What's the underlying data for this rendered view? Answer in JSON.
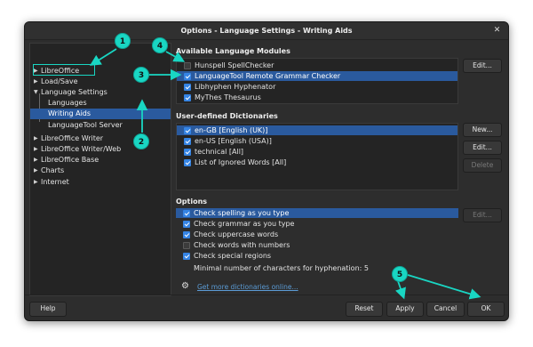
{
  "window": {
    "title": "Options - Language Settings - Writing Aids"
  },
  "tree": {
    "items": [
      {
        "label": "LibreOffice",
        "arrow": "▶"
      },
      {
        "label": "Load/Save",
        "arrow": "▶"
      },
      {
        "label": "Language Settings",
        "arrow": "▼"
      },
      {
        "label": "Languages",
        "arrow": ""
      },
      {
        "label": "Writing Aids",
        "arrow": ""
      },
      {
        "label": "LanguageTool Server",
        "arrow": ""
      },
      {
        "label": "LibreOffice Writer",
        "arrow": "▶"
      },
      {
        "label": "LibreOffice Writer/Web",
        "arrow": "▶"
      },
      {
        "label": "LibreOffice Base",
        "arrow": "▶"
      },
      {
        "label": "Charts",
        "arrow": "▶"
      },
      {
        "label": "Internet",
        "arrow": "▶"
      }
    ]
  },
  "modules": {
    "title": "Available Language Modules",
    "items": [
      {
        "label": "Hunspell SpellChecker",
        "checked": false
      },
      {
        "label": "LanguageTool Remote Grammar Checker",
        "checked": true
      },
      {
        "label": "Libhyphen Hyphenator",
        "checked": true
      },
      {
        "label": "MyThes Thesaurus",
        "checked": true
      }
    ],
    "edit_label": "Edit..."
  },
  "dictionaries": {
    "title": "User-defined Dictionaries",
    "items": [
      {
        "label": "en-GB [English (UK)]",
        "checked": true
      },
      {
        "label": "en-US [English (USA)]",
        "checked": true
      },
      {
        "label": "technical [All]",
        "checked": true
      },
      {
        "label": "List of Ignored Words [All]",
        "checked": true
      }
    ],
    "new_label": "New...",
    "edit_label": "Edit...",
    "delete_label": "Delete"
  },
  "options": {
    "title": "Options",
    "items": [
      {
        "label": "Check spelling as you type",
        "checked": true
      },
      {
        "label": "Check grammar as you type",
        "checked": true
      },
      {
        "label": "Check uppercase words",
        "checked": true
      },
      {
        "label": "Check words with numbers",
        "checked": false
      },
      {
        "label": "Check special regions",
        "checked": true
      }
    ],
    "min_chars_label": "Minimal number of characters for hyphenation:",
    "min_chars_value": "5",
    "edit_label": "Edit..."
  },
  "link_text": "Get more dictionaries online...",
  "footer": {
    "help": "Help",
    "reset": "Reset",
    "apply": "Apply",
    "cancel": "Cancel",
    "ok": "OK"
  },
  "annotations": [
    "1",
    "2",
    "3",
    "4",
    "5"
  ],
  "colors": {
    "accent": "#19d6c3",
    "selection": "#2a5a9e",
    "checkbox": "#3584e4",
    "link": "#5b9bd5"
  },
  "icons": {
    "close": "close-icon",
    "options": "gear-icon"
  }
}
